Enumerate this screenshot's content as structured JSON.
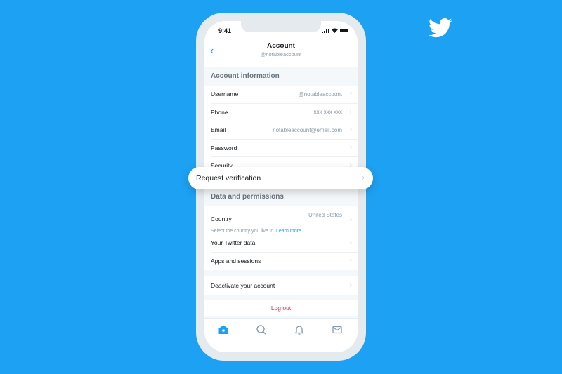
{
  "status_bar": {
    "time": "9:41"
  },
  "header": {
    "back_icon": "chevron-left",
    "title": "Account",
    "subtitle": "@notableaccount"
  },
  "account_information": {
    "heading": "Account information",
    "items": [
      {
        "label": "Username",
        "value": "@notableaccount"
      },
      {
        "label": "Phone",
        "value": "xxx xxx xxx"
      },
      {
        "label": "Email",
        "value": "notableaccount@email.com"
      },
      {
        "label": "Password",
        "value": ""
      },
      {
        "label": "Security",
        "value": ""
      }
    ]
  },
  "highlight": {
    "label": "Request verification"
  },
  "data_permissions": {
    "heading": "Data and permissions",
    "country": {
      "label": "Country",
      "value": "United States",
      "hint": "Select the country you live in.",
      "hint_link": "Learn more"
    },
    "items": [
      {
        "label": "Your Twitter data"
      },
      {
        "label": "Apps and sessions"
      }
    ]
  },
  "deactivate": {
    "label": "Deactivate your account"
  },
  "logout": {
    "label": "Log out"
  },
  "tabbar": {
    "tabs": [
      "home",
      "search",
      "notifications",
      "messages"
    ],
    "active": "home"
  },
  "colors": {
    "brand": "#1da1f2",
    "logout": "#e0245e"
  }
}
